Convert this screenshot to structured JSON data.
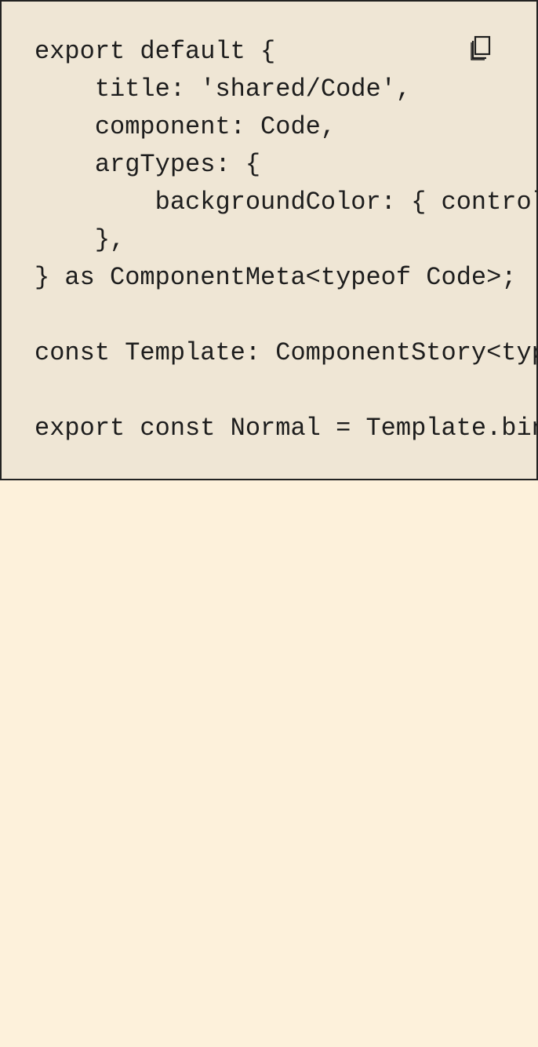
{
  "code": {
    "lines": [
      "export default {",
      "    title: 'shared/Code',",
      "    component: Code,",
      "    argTypes: {",
      "        backgroundColor: { control: 'color' },",
      "    },",
      "} as ComponentMeta<typeof Code>;",
      "",
      "const Template: ComponentStory<typeof Code> = (args) => <Code {...args} />;",
      "",
      "export const Normal = Template.bind({});"
    ]
  },
  "icons": {
    "copy": "copy-icon"
  },
  "colors": {
    "page_background": "#fdf1db",
    "code_background": "#efe6d5",
    "border": "#222222",
    "text": "#1d1d1d"
  }
}
